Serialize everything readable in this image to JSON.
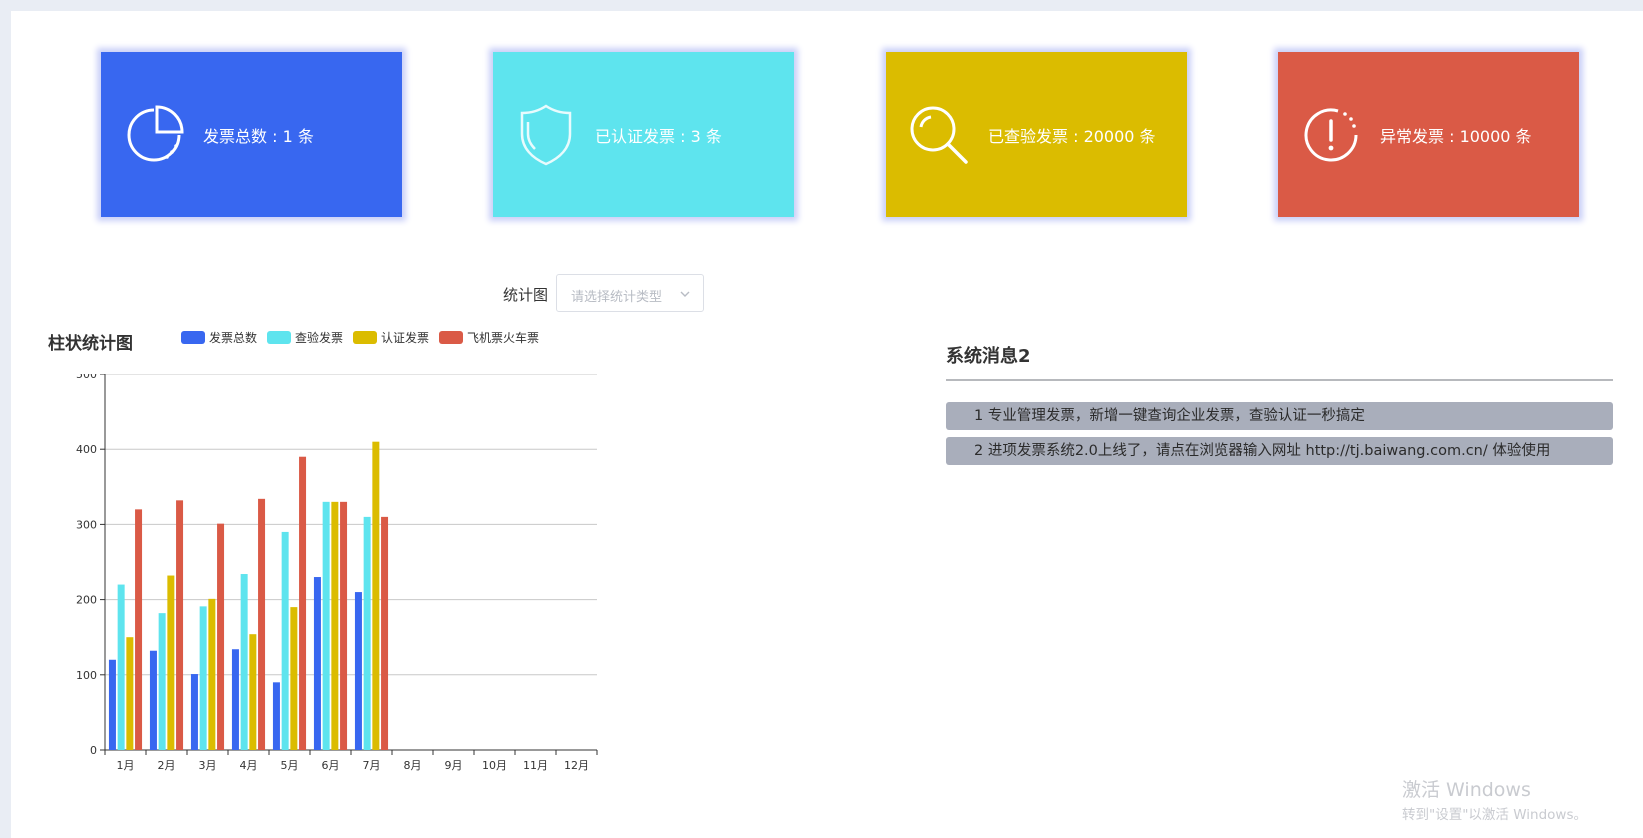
{
  "cards": [
    {
      "text": "发票总数 : 1 条",
      "icon": "pie-chart-icon",
      "color": "#3867f0"
    },
    {
      "text": "已认证发票 : 3 条",
      "icon": "shield-icon",
      "color": "#5ee4ee"
    },
    {
      "text": "已查验发票 : 20000 条",
      "icon": "search-icon",
      "color": "#dbbc00"
    },
    {
      "text": "异常发票 : 10000 条",
      "icon": "alert-circle-icon",
      "color": "#da5a46"
    }
  ],
  "filter": {
    "label": "统计图",
    "placeholder": "请选择统计类型"
  },
  "chart_data": {
    "type": "bar",
    "title": "柱状统计图",
    "categories": [
      "1月",
      "2月",
      "3月",
      "4月",
      "5月",
      "6月",
      "7月",
      "8月",
      "9月",
      "10月",
      "11月",
      "12月"
    ],
    "series": [
      {
        "name": "发票总数",
        "color": "#3867f0",
        "values": [
          120,
          132,
          101,
          134,
          90,
          230,
          210,
          null,
          null,
          null,
          null,
          null
        ]
      },
      {
        "name": "查验发票",
        "color": "#5ee4ee",
        "values": [
          220,
          182,
          191,
          234,
          290,
          330,
          310,
          null,
          null,
          null,
          null,
          null
        ]
      },
      {
        "name": "认证发票",
        "color": "#dbbc00",
        "values": [
          150,
          232,
          201,
          154,
          190,
          330,
          410,
          null,
          null,
          null,
          null,
          null
        ]
      },
      {
        "name": "飞机票火车票",
        "color": "#da5a46",
        "values": [
          320,
          332,
          301,
          334,
          390,
          330,
          310,
          null,
          null,
          null,
          null,
          null
        ]
      }
    ],
    "yticks": [
      0,
      100,
      200,
      300,
      400,
      500
    ],
    "ylim": [
      0,
      500
    ],
    "grid": true,
    "legend_position": "top"
  },
  "messages": {
    "title": "系统消息2",
    "items": [
      "1 专业管理发票，新增一键查询企业发票，查验认证一秒搞定",
      "2 进项发票系统2.0上线了，请点在浏览器输入网址 http://tj.baiwang.com.cn/ 体验使用"
    ]
  },
  "watermark": {
    "line1": "激活 Windows",
    "line2": "转到\"设置\"以激活 Windows。"
  }
}
